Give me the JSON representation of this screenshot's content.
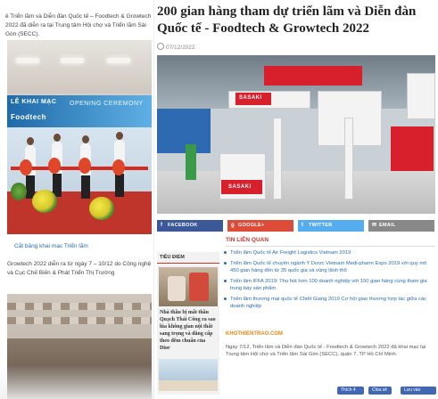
{
  "left": {
    "top_text": "ẻ  Triển lãm và Diễn đàn Quốc tế – Foodtech & Growtech 2022 đã diễn ra tại Trung tâm Hội chợ và Triển lãm Sài Gòn (SECC).",
    "photo": {
      "banner_text": "LỄ KHAI MẠC",
      "banner_text2": "OPENING CEREMONY",
      "banner_text3": "Foodtech"
    },
    "caption": "Cắt băng khai mạc Triển lãm",
    "para": "Growtech 2022 diễn ra từ ngày 7 – 10/12 do Công nghệ và Cục Chế Biến & Phát Triển Thị Trường"
  },
  "article": {
    "title": "200 gian hàng tham dự triển lãm và Diễn đàn Quốc tế - Foodtech & Growtech 2022",
    "date": "07/12/2022",
    "photo_brand": "SASAKI"
  },
  "share": {
    "facebook": "FACEBOOK",
    "google": "GOOGLE+",
    "twitter": "TWITTER",
    "email": "EMAIL"
  },
  "sidebar": {
    "title": "TIÊU ĐIỂM",
    "item_title": "Nhà thầu bị mất thầu Quạch Thái Công ra sao lúa không gian nội thất sang trọng và đẳng cấp theo đêm chuẩn của Dior"
  },
  "related": {
    "title": "TIN LIÊN QUAN",
    "items": [
      "Triển lãm Quốc tế Air Freight Logistics Vietnam 2019",
      "Triển lãm Quốc tế chuyên ngành Y Dược Vietnam Medi-pharm Expo 2019 với quy mô 450 gian hàng đến từ 35 quốc gia và vùng lãnh thổ",
      "Triển lãm IFFA 2019: Thu hút hơn 100 doanh nghiệp với 150 gian hàng cùng tham gia trung bày sản phẩm",
      "Triển lãm thương mại quốc tế Chiết Giang 2019 Cơ hội giao thương hợp tác giữa các doanh nghiệp"
    ]
  },
  "source_label": "KHOTHIENTRAO.COM",
  "article_text": "Ngày 7/12, Triển lãm và Diễn đàn Quốc tế - Foodtech & Growtech 2022 đã khai mạc tại Trung tâm Hội chợ và Triển lãm Sài Gòn (SECC), quận 7, TP Hồ Chí Minh.",
  "social": {
    "like": "Thích 4",
    "share": "Chia sẻ",
    "save": "Lưu vào Facebook"
  },
  "colors": {
    "facebook": "#3b5998",
    "google": "#dd4b39",
    "twitter": "#55acee",
    "email": "#888888",
    "related_title": "#c0392b",
    "link": "#2b6cb0",
    "source": "#e38b1a"
  }
}
